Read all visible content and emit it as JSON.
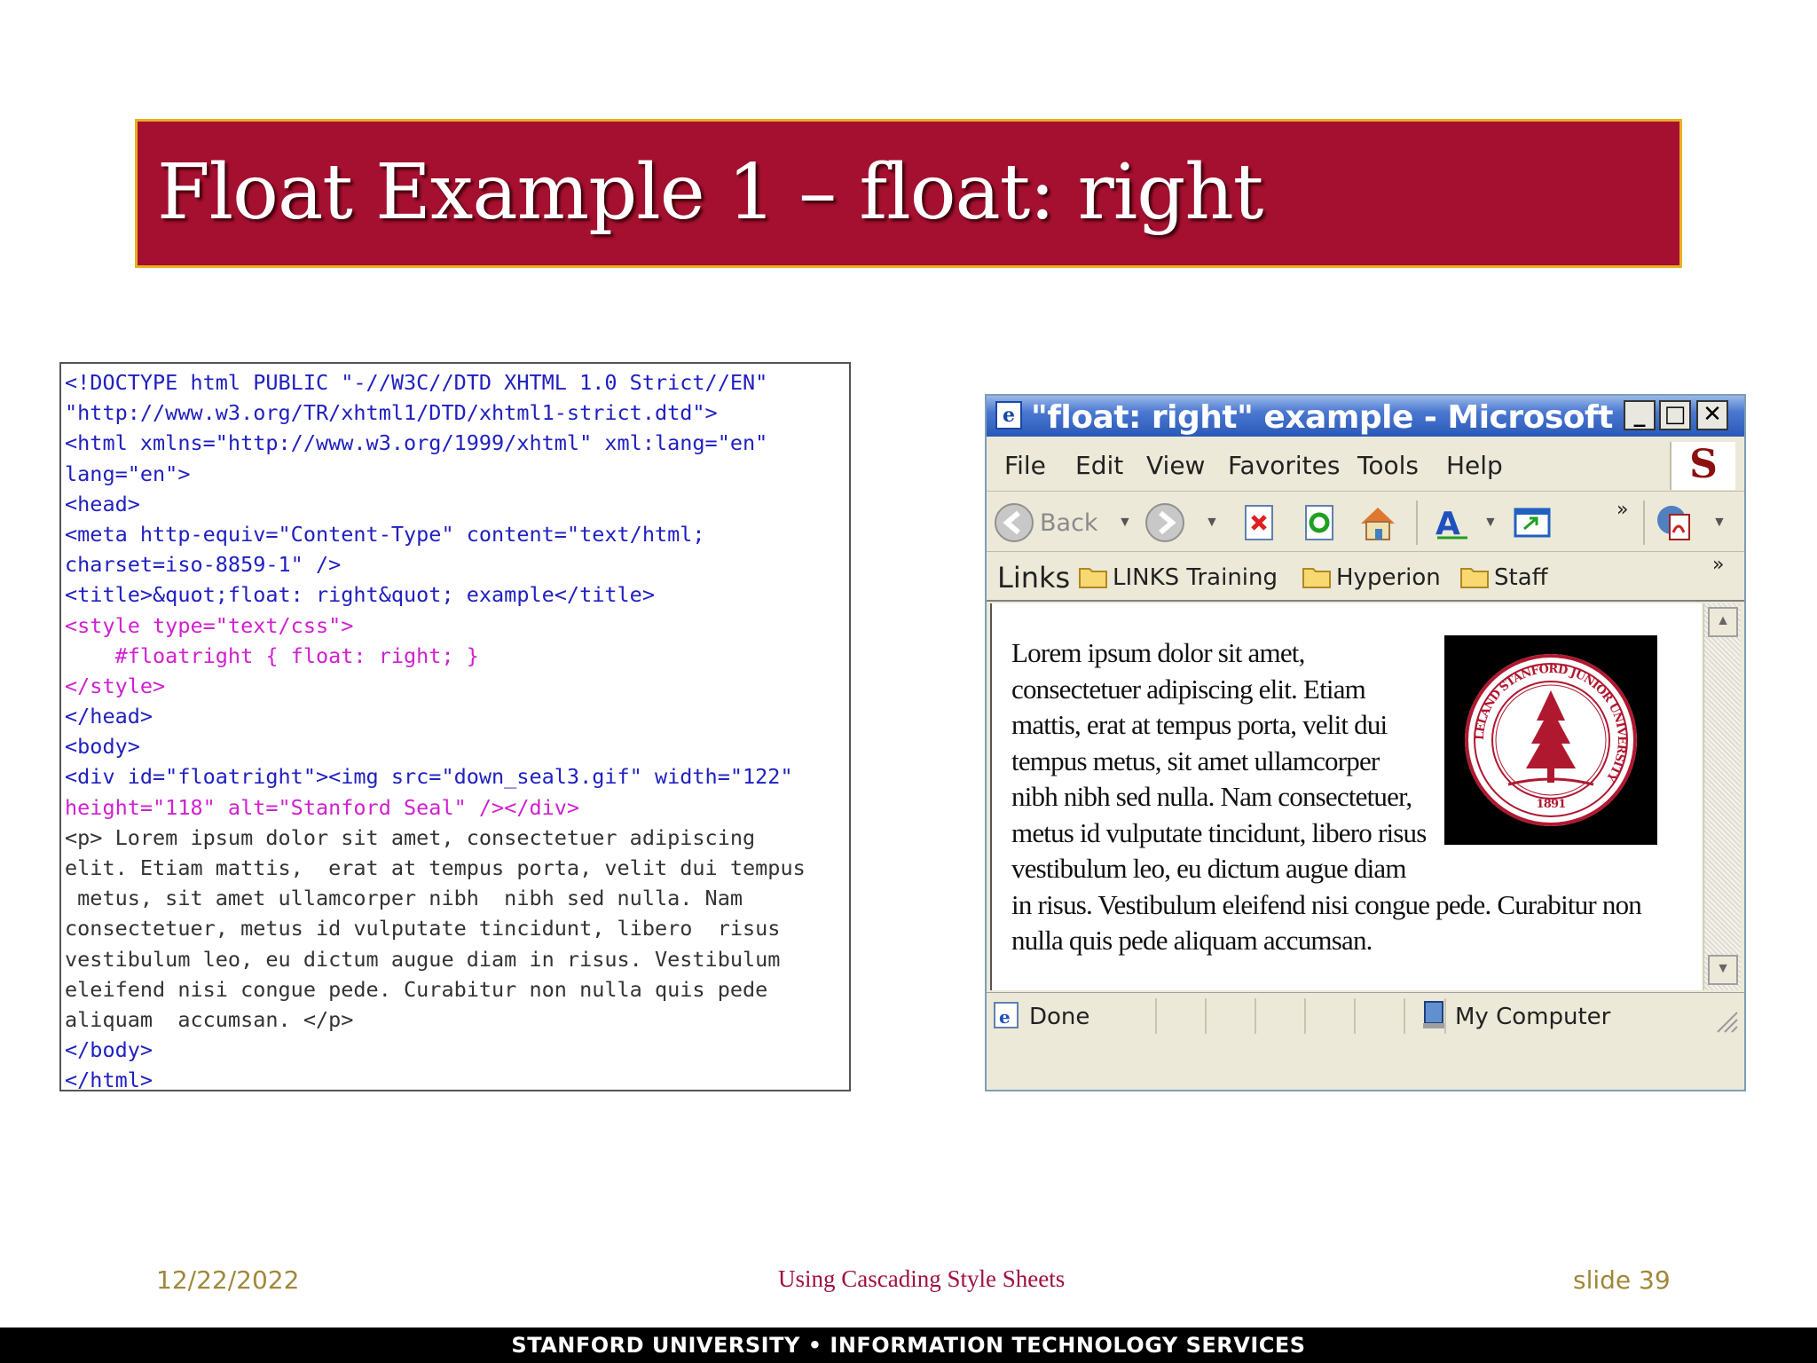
{
  "slide": {
    "title": "Float Example 1 – float: right",
    "footer_date": "12/22/2022",
    "footer_title": "Using Cascading Style Sheets",
    "footer_slide": "slide 39",
    "bottom_band": "STANFORD UNIVERSITY • INFORMATION TECHNOLOGY SERVICES"
  },
  "code": {
    "lines": [
      {
        "text": "<!DOCTYPE html PUBLIC \"-//W3C//DTD XHTML 1.0 Strict//EN\"",
        "color": "blue"
      },
      {
        "text": "\"http://www.w3.org/TR/xhtml1/DTD/xhtml1-strict.dtd\">",
        "color": "blue"
      },
      {
        "text": "<html xmlns=\"http://www.w3.org/1999/xhtml\" xml:lang=\"en\"",
        "color": "blue"
      },
      {
        "text": "lang=\"en\">",
        "color": "blue"
      },
      {
        "text": "<head>",
        "color": "blue"
      },
      {
        "text": "<meta http-equiv=\"Content-Type\" content=\"text/html;",
        "color": "blue"
      },
      {
        "text": "charset=iso-8859-1\" />",
        "color": "blue"
      },
      {
        "text": "<title>&quot;float: right&quot; example</title>",
        "color": "blue"
      },
      {
        "text": "<style type=\"text/css\">",
        "color": "pink"
      },
      {
        "text": "    #floatright { float: right; }",
        "color": "pink"
      },
      {
        "text": "</style>",
        "color": "pink"
      },
      {
        "text": "</head>",
        "color": "blue"
      },
      {
        "text": "<body>",
        "color": "blue"
      },
      {
        "text": "<div id=\"floatright\"><img src=\"down_seal3.gif\" width=\"122\"",
        "color": "blue"
      },
      {
        "text": "height=\"118\" alt=\"Stanford Seal\" /></div>",
        "color": "pink"
      },
      {
        "text": "<p> Lorem ipsum dolor sit amet, consectetuer adipiscing",
        "color": "dark"
      },
      {
        "text": "elit. Etiam mattis,  erat at tempus porta, velit dui tempus",
        "color": "dark"
      },
      {
        "text": " metus, sit amet ullamcorper nibh  nibh sed nulla. Nam",
        "color": "dark"
      },
      {
        "text": "consectetuer, metus id vulputate tincidunt, libero  risus",
        "color": "dark"
      },
      {
        "text": "vestibulum leo, eu dictum augue diam in risus. Vestibulum",
        "color": "dark"
      },
      {
        "text": "eleifend nisi congue pede. Curabitur non nulla quis pede",
        "color": "dark"
      },
      {
        "text": "aliquam  accumsan. </p>",
        "color": "dark"
      },
      {
        "text": "</body>",
        "color": "blue"
      },
      {
        "text": "</html>",
        "color": "blue"
      }
    ]
  },
  "browser": {
    "window_title": "\"float: right\" example - Microsoft In...",
    "controls": {
      "minimize": "_",
      "maximize": "□",
      "close": "✕"
    },
    "menu": [
      "File",
      "Edit",
      "View",
      "Favorites",
      "Tools",
      "Help"
    ],
    "logo_letter": "S",
    "toolbar": {
      "back_label": "Back",
      "more": "»"
    },
    "links": {
      "label": "Links",
      "items": [
        "LINKS Training",
        "Hyperion",
        "Staff"
      ],
      "more": "»"
    },
    "content": "Lorem ipsum dolor sit amet, consectetuer adipiscing elit. Etiam mattis, erat at tempus porta, velit dui tempus metus, sit amet ullamcorper nibh nibh sed nulla. Nam consectetuer, metus id vulputate tincidunt, libero risus vestibulum leo, eu dictum augue diam in risus. Vestibulum eleifend nisi congue pede. Curabitur non nulla quis pede aliquam accumsan.",
    "seal": {
      "year": "1891",
      "ring_text": "LELAND STANFORD JUNIOR UNIVERSITY"
    },
    "status": {
      "left": "Done",
      "zone": "My Computer"
    }
  },
  "colors": {
    "title_bg": "#a51030",
    "title_border": "#e8b020",
    "code_blue": "#2020c0",
    "code_pink": "#d020d0"
  }
}
